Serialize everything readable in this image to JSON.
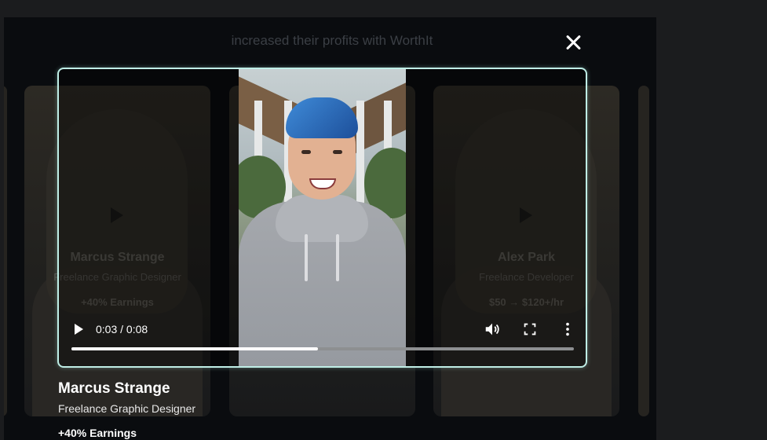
{
  "headline": "increased their profits with WorthIt",
  "cards": [
    {
      "name": "Marcus Strange",
      "role": "Freelance Graphic Designer",
      "stat": "+40% Earnings"
    },
    {
      "name": "Alex Park",
      "role": "Freelance Developer",
      "stat": "$50 → $120+/hr"
    }
  ],
  "player": {
    "time": "0:03 / 0:08",
    "progress": 0.49
  },
  "caption": {
    "name": "Marcus Strange",
    "role": "Freelance Graphic Designer",
    "stat": "+40% Earnings"
  },
  "colors": {
    "modal_border": "#bfeee6",
    "hair": "#3f8bd8",
    "hoodie": "#a5a8ad"
  },
  "icons": [
    "close-icon",
    "play-icon",
    "volume-icon",
    "fullscreen-icon",
    "more-options-icon"
  ]
}
